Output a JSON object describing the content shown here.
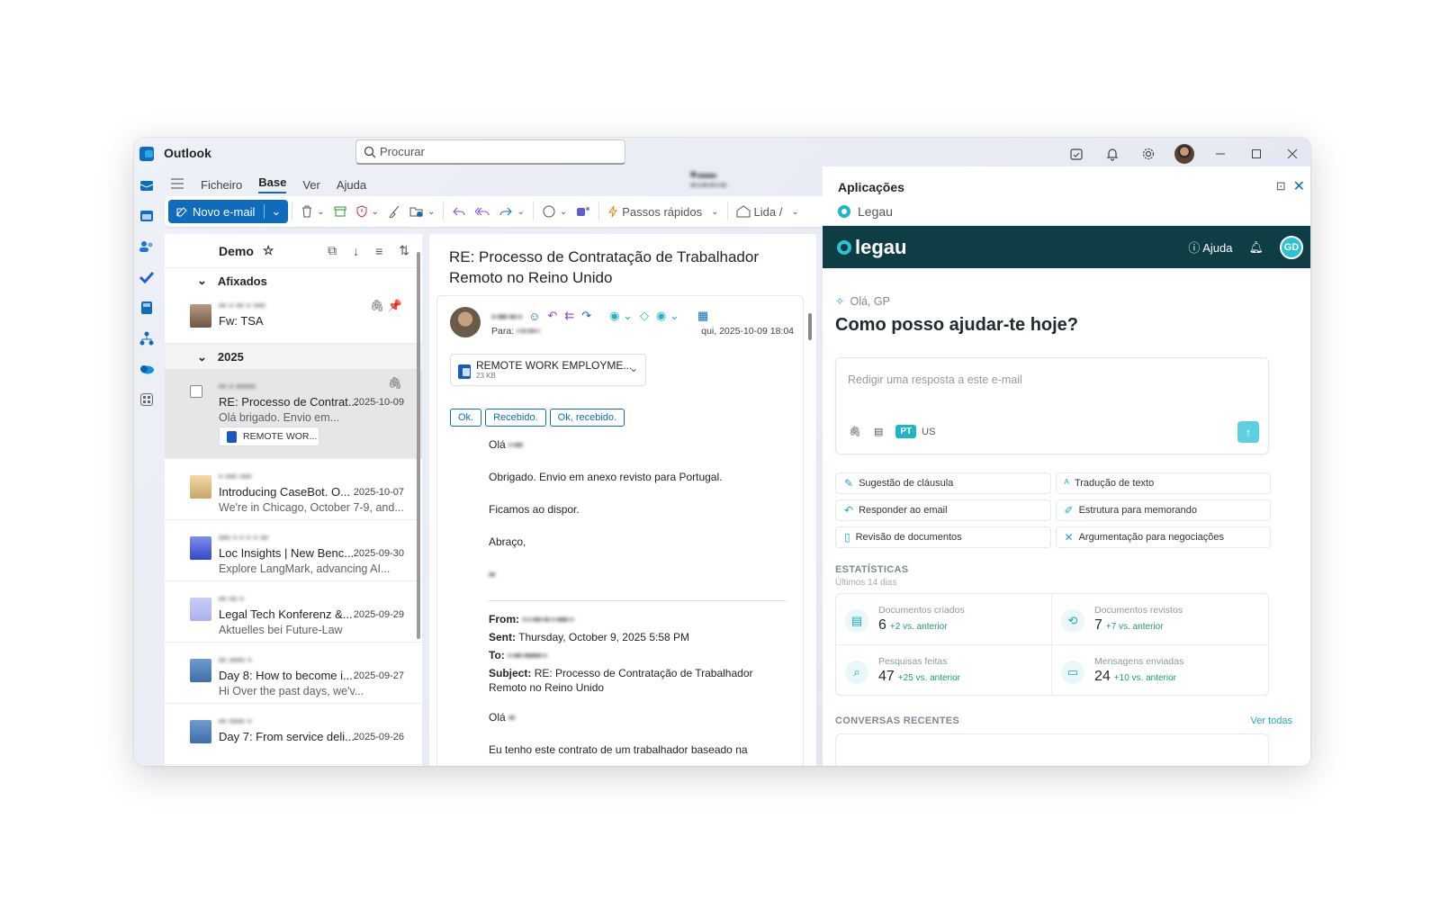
{
  "app": {
    "title": "Outlook"
  },
  "search": {
    "placeholder": "Procurar"
  },
  "ribbon": {
    "tabs": [
      "Ficheiro",
      "Base",
      "Ver",
      "Ajuda"
    ],
    "new_mail": "Novo e-mail",
    "quick_steps": "Passos rápidos",
    "read_unread": "Lida /"
  },
  "list": {
    "folder": "Demo",
    "groups": {
      "pinned": "Afixados",
      "year": "2025"
    },
    "pinned": {
      "subject": "Fw: TSA"
    },
    "items": [
      {
        "subject": "RE: Processo de Contrat...",
        "date": "2025-10-09",
        "preview": "Olá          brigado. Envio em...",
        "attachment": "REMOTE WOR..."
      },
      {
        "subject": "Introducing CaseBot. O...",
        "date": "2025-10-07",
        "preview": "We're in Chicago, October 7-9, and..."
      },
      {
        "subject": "Loc Insights | New Benc...",
        "date": "2025-09-30",
        "preview": "Explore LangMark, advancing AI..."
      },
      {
        "subject": "Legal Tech Konferenz &...",
        "date": "2025-09-29",
        "preview": "Aktuelles bei Future-Law"
      },
      {
        "subject": "Day 8: How to become i...",
        "date": "2025-09-27",
        "preview": "Hi          Over the past days, we'v..."
      },
      {
        "subject": "Day 7: From service deli...",
        "date": "2025-09-26",
        "preview": ""
      }
    ]
  },
  "reader": {
    "title": "RE: Processo de Contratação de Trabalhador Remoto no Reino Unido",
    "to_label": "Para:",
    "date": "qui, 2025-10-09 18:04",
    "attachment": {
      "name": "REMOTE WORK EMPLOYME...",
      "size": "23 KB"
    },
    "quick_replies": [
      "Ok.",
      "Recebido.",
      "Ok, recebido."
    ],
    "greeting": "Olá",
    "body": [
      "Obrigado. Envio em anexo revisto para Portugal.",
      "Ficamos ao dispor.",
      "Abraço,"
    ],
    "from_label": "From:",
    "sent_label": "Sent:",
    "sent_value": "Thursday, October 9, 2025 5:58 PM",
    "to2_label": "To:",
    "subject_label": "Subject:",
    "subject_value": "RE: Processo de Contratação de Trabalhador Remoto no Reino Unido",
    "greeting2": "Olá",
    "body2": "Eu tenho este contrato de um trabalhador baseado na"
  },
  "panel": {
    "title": "Aplicações",
    "app_name": "Legau",
    "brand": "legau",
    "help": "Ajuda",
    "user_initials": "GD",
    "greeting": "Olá, GP",
    "question": "Como posso ajudar-te hoje?",
    "compose_placeholder": "Redigir uma resposta a este e-mail",
    "lang_pt": "PT",
    "lang_us": "US",
    "actions": [
      "Sugestão de cláusula",
      "Tradução de texto",
      "Responder ao email",
      "Estrutura para memorando",
      "Revisão de documentos",
      "Argumentação para negociações"
    ],
    "stats_title": "ESTATÍSTICAS",
    "stats_sub": "Últimos 14 dias",
    "stats": [
      {
        "label": "Documentos criados",
        "value": "6",
        "delta": "+2 vs. anterior"
      },
      {
        "label": "Documentos revistos",
        "value": "7",
        "delta": "+7 vs. anterior"
      },
      {
        "label": "Pesquisas feitas",
        "value": "47",
        "delta": "+25 vs. anterior"
      },
      {
        "label": "Mensagens enviadas",
        "value": "24",
        "delta": "+10 vs. anterior"
      }
    ],
    "recent_title": "CONVERSAS RECENTES",
    "see_all": "Ver todas"
  },
  "colors": {
    "outlook_blue": "#0f6cbd",
    "legau_dark": "#0e3d45",
    "legau_accent": "#1fb4c8"
  }
}
